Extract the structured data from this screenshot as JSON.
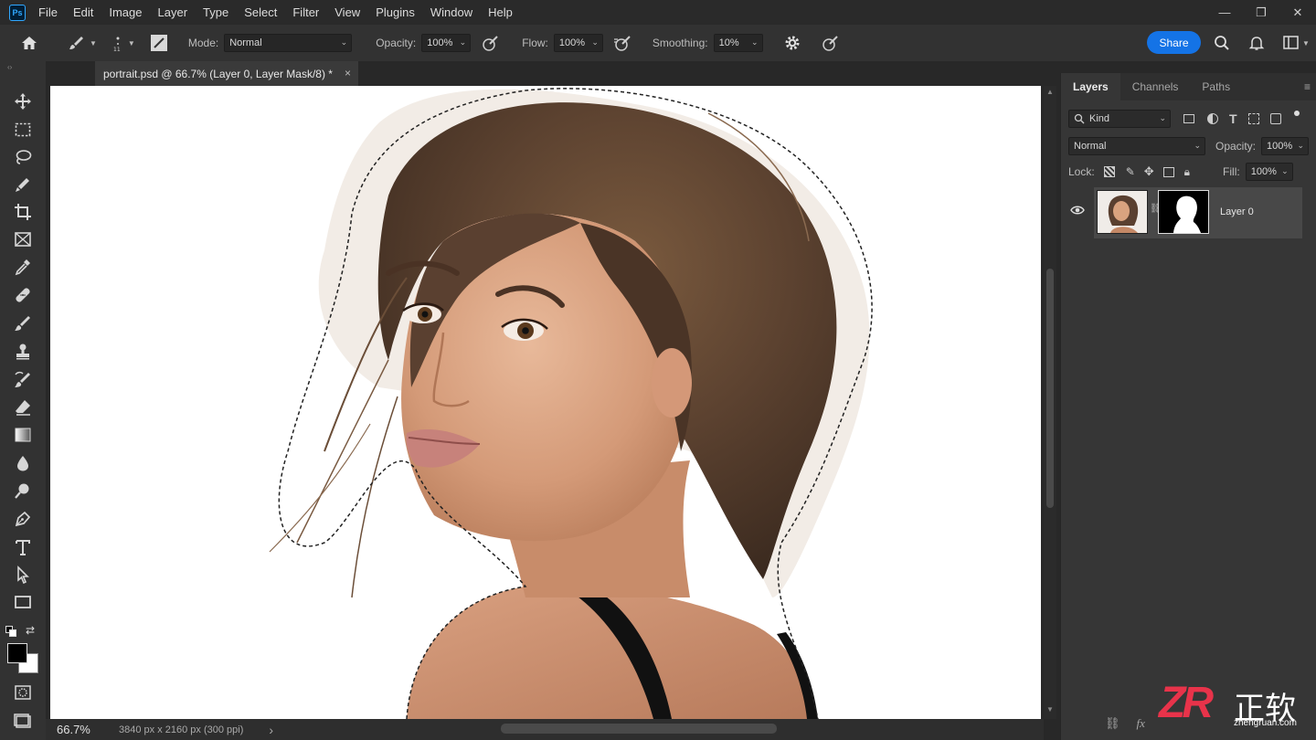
{
  "app": {
    "logo": "Ps"
  },
  "menu": [
    "File",
    "Edit",
    "Image",
    "Layer",
    "Type",
    "Select",
    "Filter",
    "View",
    "Plugins",
    "Window",
    "Help"
  ],
  "window_controls": {
    "minimize": "—",
    "restore": "❐",
    "close": "✕"
  },
  "options": {
    "mode_label": "Mode:",
    "mode_value": "Normal",
    "opacity_label": "Opacity:",
    "opacity_value": "100%",
    "flow_label": "Flow:",
    "flow_value": "100%",
    "smoothing_label": "Smoothing:",
    "smoothing_value": "10%",
    "share_label": "Share"
  },
  "document": {
    "tab_title": "portrait.psd @ 66.7% (Layer 0, Layer Mask/8) *",
    "close": "×"
  },
  "status": {
    "zoom": "66.7%",
    "doc_size": "3840 px x 2160 px (300 ppi)",
    "arrow": "›"
  },
  "layers_panel": {
    "tabs": [
      "Layers",
      "Channels",
      "Paths"
    ],
    "active_tab": "Layers",
    "filter_kind": "Kind",
    "blend_mode": "Normal",
    "opacity_label": "Opacity:",
    "opacity_value": "100%",
    "lock_label": "Lock:",
    "fill_label": "Fill:",
    "fill_value": "100%",
    "layers": [
      {
        "name": "Layer 0",
        "visible": true,
        "has_mask": true
      }
    ]
  },
  "watermark": {
    "logo": "ZR",
    "text": "正软",
    "url": "zhengruan.com"
  },
  "colors": {
    "accent": "#1473e6",
    "panel": "#363636",
    "canvas_bg": "#282828",
    "selected_layer": "#484848"
  }
}
